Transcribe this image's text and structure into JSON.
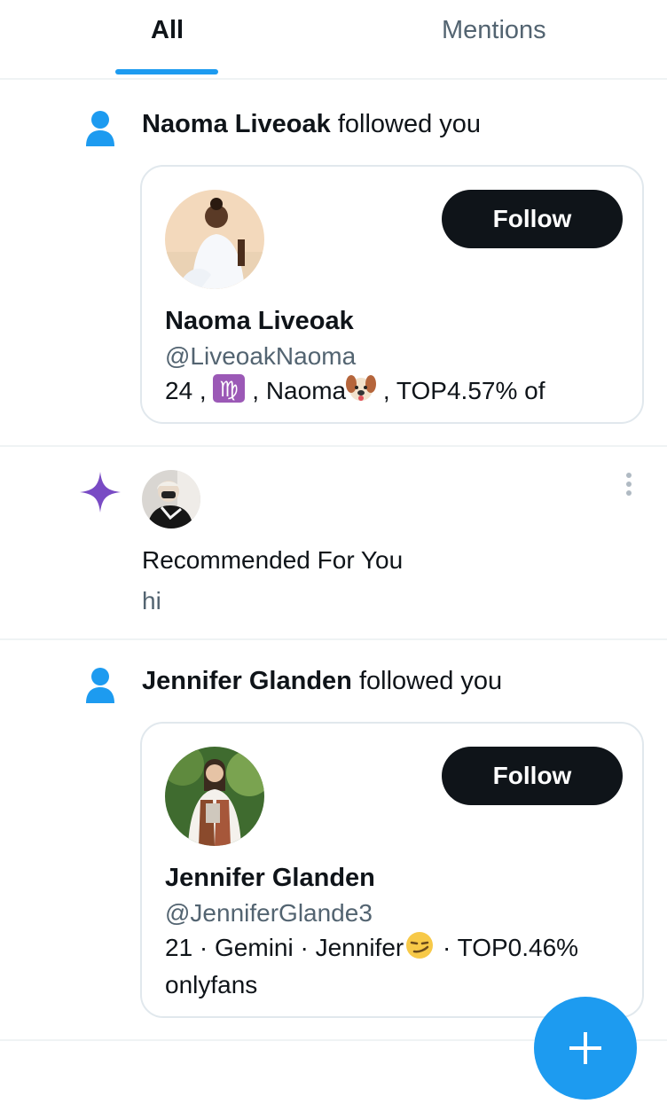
{
  "tabs": {
    "all": "All",
    "mentions": "Mentions"
  },
  "notifications": [
    {
      "name": "Naoma Liveoak",
      "action": "followed you",
      "card": {
        "name": "Naoma Liveoak",
        "handle": "@LiveoakNaoma",
        "bio_a": "24 ,",
        "bio_emoji1": "♍",
        "bio_b": ", Naoma",
        "bio_emoji2": "🐶",
        "bio_c": ", TOP4.57% of",
        "follow_label": "Follow"
      }
    },
    {
      "name": "Jennifer Glanden",
      "action": "followed you",
      "card": {
        "name": "Jennifer Glanden",
        "handle": "@JenniferGlande3",
        "bio_a": "21 · Gemini · Jennifer",
        "bio_emoji1": "😏",
        "bio_b": "· TOP0.46%",
        "bio_c": "onlyfans",
        "follow_label": "Follow"
      }
    }
  ],
  "recommended": {
    "title": "Recommended For You",
    "text": "hi"
  },
  "colors": {
    "accent": "#1d9bf0",
    "sparkle": "#794bc4",
    "button": "#0f1419",
    "muted": "#536471"
  },
  "icons": [
    "person-icon",
    "sparkle-icon",
    "more-vertical-icon",
    "plus-icon"
  ]
}
